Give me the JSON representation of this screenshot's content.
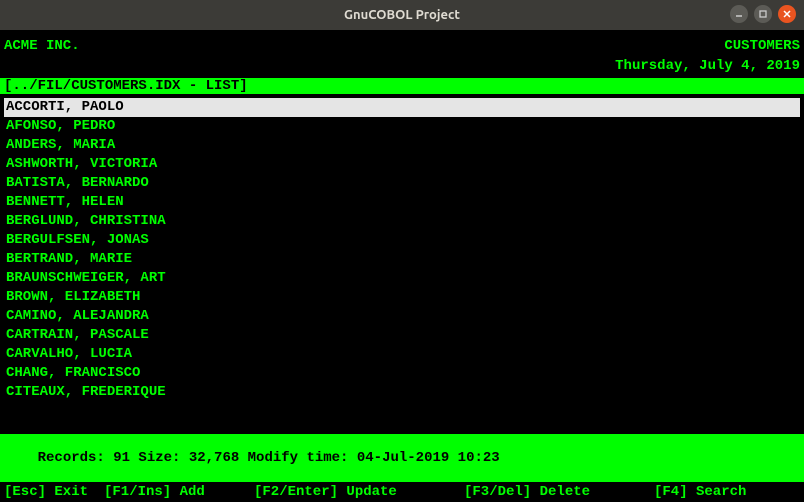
{
  "window": {
    "title": "GnuCOBOL Project"
  },
  "header": {
    "company": "ACME INC.",
    "screen": "CUSTOMERS",
    "date": "Thursday, July 4, 2019"
  },
  "path": "[../FIL/CUSTOMERS.IDX - LIST]",
  "records": [
    "ACCORTI, PAOLO",
    "AFONSO, PEDRO",
    "ANDERS, MARIA",
    "ASHWORTH, VICTORIA",
    "BATISTA, BERNARDO",
    "BENNETT, HELEN",
    "BERGLUND, CHRISTINA",
    "BERGULFSEN, JONAS",
    "BERTRAND, MARIE",
    "BRAUNSCHWEIGER, ART",
    "BROWN, ELIZABETH",
    "CAMINO, ALEJANDRA",
    "CARTRAIN, PASCALE",
    "CARVALHO, LUCIA",
    "CHANG, FRANCISCO",
    "CITEAUX, FREDERIQUE"
  ],
  "selected_index": 0,
  "status": "Records: 91 Size: 32,768 Modify time: 04-Jul-2019 10:23",
  "fnkeys": {
    "esc": "[Esc] Exit",
    "f1": "[F1/Ins] Add",
    "f2": "[F2/Enter] Update",
    "f3": "[F3/Del] Delete",
    "f4": "[F4] Search"
  }
}
